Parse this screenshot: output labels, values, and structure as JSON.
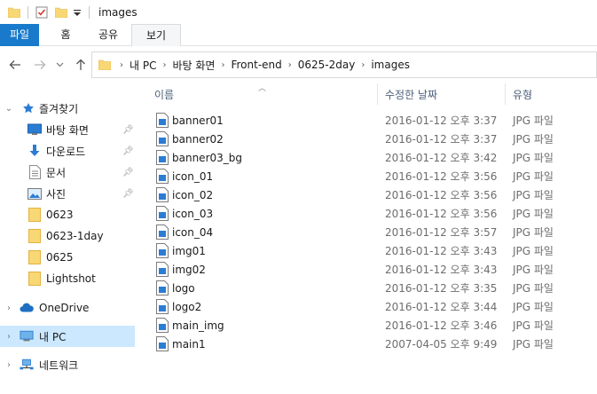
{
  "window": {
    "title": "images"
  },
  "ribbon": {
    "tabs": [
      "파일",
      "홈",
      "공유",
      "보기"
    ]
  },
  "address": {
    "segments": [
      "내 PC",
      "바탕 화면",
      "Front-end",
      "0625-2day",
      "images"
    ]
  },
  "nav": {
    "quick_access": "즐겨찾기",
    "pinned": [
      "바탕 화면",
      "다운로드",
      "문서",
      "사진"
    ],
    "folders": [
      "0623",
      "0623-1day",
      "0625",
      "Lightshot"
    ],
    "onedrive": "OneDrive",
    "this_pc": "내 PC",
    "network": "네트워크"
  },
  "columns": {
    "name": "이름",
    "date": "수정한 날짜",
    "type": "유형"
  },
  "files": [
    {
      "name": "banner01",
      "date": "2016-01-12 오후 3:37",
      "type": "JPG 파일"
    },
    {
      "name": "banner02",
      "date": "2016-01-12 오후 3:37",
      "type": "JPG 파일"
    },
    {
      "name": "banner03_bg",
      "date": "2016-01-12 오후 3:42",
      "type": "JPG 파일"
    },
    {
      "name": "icon_01",
      "date": "2016-01-12 오후 3:56",
      "type": "JPG 파일"
    },
    {
      "name": "icon_02",
      "date": "2016-01-12 오후 3:56",
      "type": "JPG 파일"
    },
    {
      "name": "icon_03",
      "date": "2016-01-12 오후 3:56",
      "type": "JPG 파일"
    },
    {
      "name": "icon_04",
      "date": "2016-01-12 오후 3:57",
      "type": "JPG 파일"
    },
    {
      "name": "img01",
      "date": "2016-01-12 오후 3:43",
      "type": "JPG 파일"
    },
    {
      "name": "img02",
      "date": "2016-01-12 오후 3:43",
      "type": "JPG 파일"
    },
    {
      "name": "logo",
      "date": "2016-01-12 오후 3:35",
      "type": "JPG 파일"
    },
    {
      "name": "logo2",
      "date": "2016-01-12 오후 3:44",
      "type": "JPG 파일"
    },
    {
      "name": "main_img",
      "date": "2016-01-12 오후 3:46",
      "type": "JPG 파일"
    },
    {
      "name": "main1",
      "date": "2007-04-05 오후 9:49",
      "type": "JPG 파일"
    }
  ]
}
